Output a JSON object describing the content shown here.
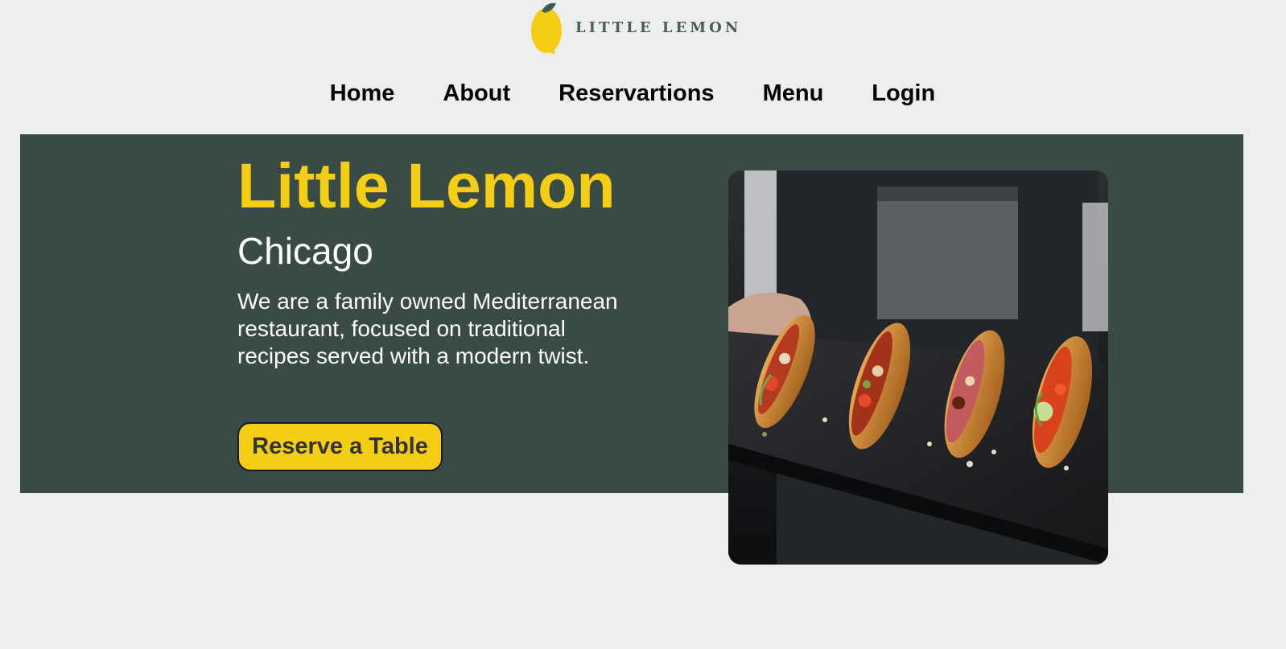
{
  "header": {
    "logo_text": "LITTLE LEMON",
    "logo_icon": "lemon-icon"
  },
  "nav": {
    "items": [
      {
        "label": "Home"
      },
      {
        "label": "About"
      },
      {
        "label": "Reservartions"
      },
      {
        "label": "Menu"
      },
      {
        "label": "Login"
      }
    ]
  },
  "hero": {
    "title": "Little Lemon",
    "subtitle": "Chicago",
    "description": "We are a family owned Mediterranean restaurant, focused on traditional recipes served with a modern twist.",
    "button_label": "Reserve a Table",
    "image_icon": "bruschetta-tray-photo"
  },
  "colors": {
    "primary_green": "#495e57",
    "hero_background": "#3a4a45",
    "primary_yellow": "#f4ce14",
    "page_background": "#edefee"
  }
}
